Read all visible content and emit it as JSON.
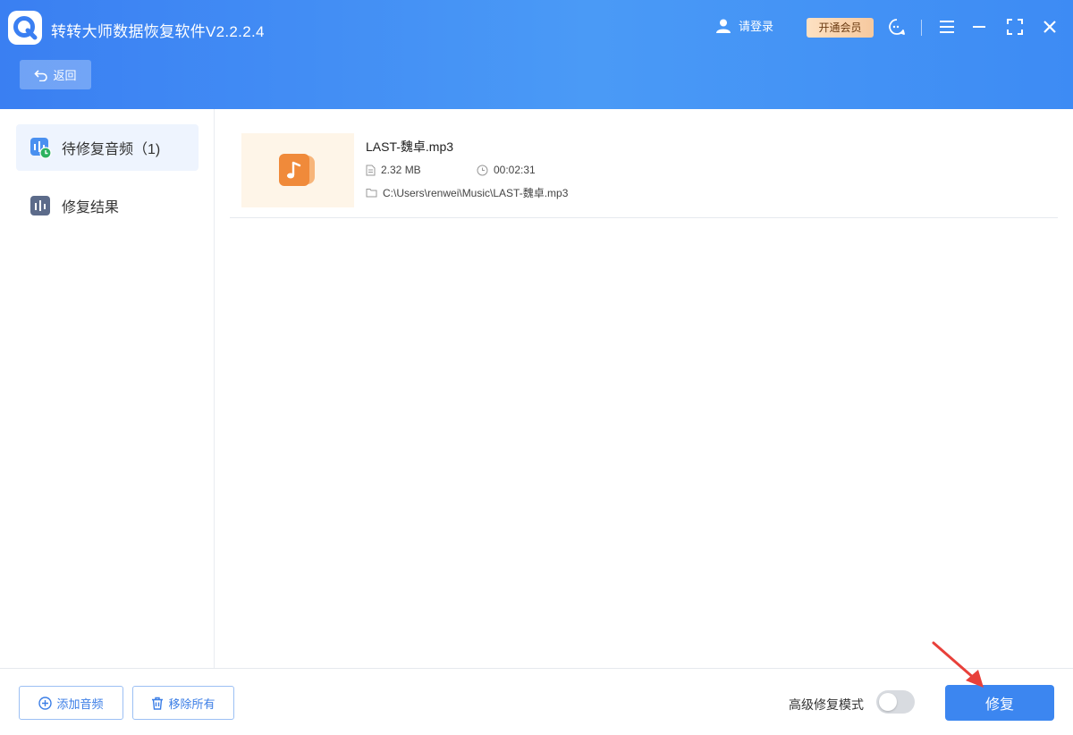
{
  "app": {
    "title": "转转大师数据恢复软件V2.2.2.4"
  },
  "header": {
    "login_label": "请登录",
    "vip_label": "开通会员",
    "back_label": "返回"
  },
  "sidebar": {
    "items": [
      {
        "label": "待修复音频（1)",
        "active": true,
        "icon": "audio-pending-icon"
      },
      {
        "label": "修复结果",
        "active": false,
        "icon": "audio-result-icon"
      }
    ]
  },
  "files": [
    {
      "name": "LAST-魏卓.mp3",
      "size": "2.32 MB",
      "duration": "00:02:31",
      "path": "C:\\Users\\renwei\\Music\\LAST-魏卓.mp3",
      "icon": "music-note-icon"
    }
  ],
  "footer": {
    "add_label": "添加音频",
    "remove_label": "移除所有",
    "advanced_label": "高级修复模式",
    "advanced_enabled": false,
    "repair_label": "修复"
  },
  "colors": {
    "header_start": "#3a7ff2",
    "header_end": "#4a9af6",
    "accent": "#3c86f0",
    "vip_bg": "#f6c99f",
    "thumb_bg": "#fef5e8",
    "thumb_icon": "#f08a3a",
    "annotation_arrow": "#e8403a"
  }
}
